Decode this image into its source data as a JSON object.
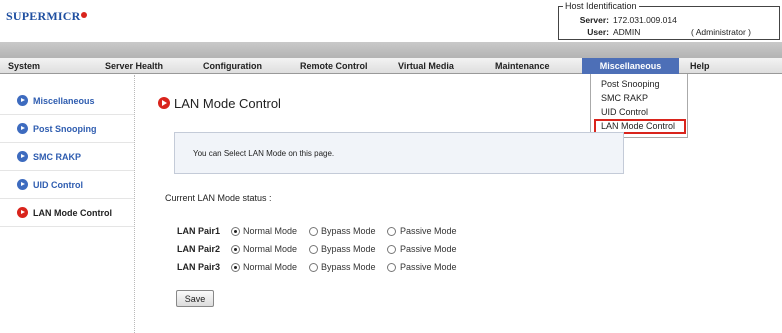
{
  "logo": "SUPERMICR",
  "host": {
    "box_title": "Host Identification",
    "server_label": "Server:",
    "server_value": "172.031.009.014",
    "user_label": "User:",
    "user_value": "ADMIN",
    "user_role": "( Administrator )"
  },
  "menu": [
    {
      "label": "System"
    },
    {
      "label": "Server Health"
    },
    {
      "label": "Configuration"
    },
    {
      "label": "Remote Control"
    },
    {
      "label": "Virtual Media"
    },
    {
      "label": "Maintenance"
    },
    {
      "label": "Miscellaneous",
      "active": true
    },
    {
      "label": "Help"
    }
  ],
  "dropdown": [
    "Post Snooping",
    "SMC RAKP",
    "UID Control",
    "LAN Mode Control"
  ],
  "sidebar": [
    {
      "label": "Miscellaneous"
    },
    {
      "label": "Post Snooping"
    },
    {
      "label": "SMC RAKP"
    },
    {
      "label": "UID Control"
    },
    {
      "label": "LAN Mode Control",
      "current": true
    }
  ],
  "page": {
    "title": "LAN Mode Control",
    "info": "You can Select LAN Mode on this page.",
    "status_label": "Current LAN Mode status :",
    "modes": [
      "Normal Mode",
      "Bypass Mode",
      "Passive Mode"
    ],
    "lan_pairs": [
      {
        "name": "LAN Pair1",
        "selected": "Normal Mode"
      },
      {
        "name": "LAN Pair2",
        "selected": "Normal Mode"
      },
      {
        "name": "LAN Pair3",
        "selected": "Normal Mode"
      }
    ],
    "save_label": "Save"
  },
  "colors": {
    "accent_blue": "#4d6fb7",
    "link_blue": "#2f5db0",
    "highlight_red": "#d9241c"
  }
}
